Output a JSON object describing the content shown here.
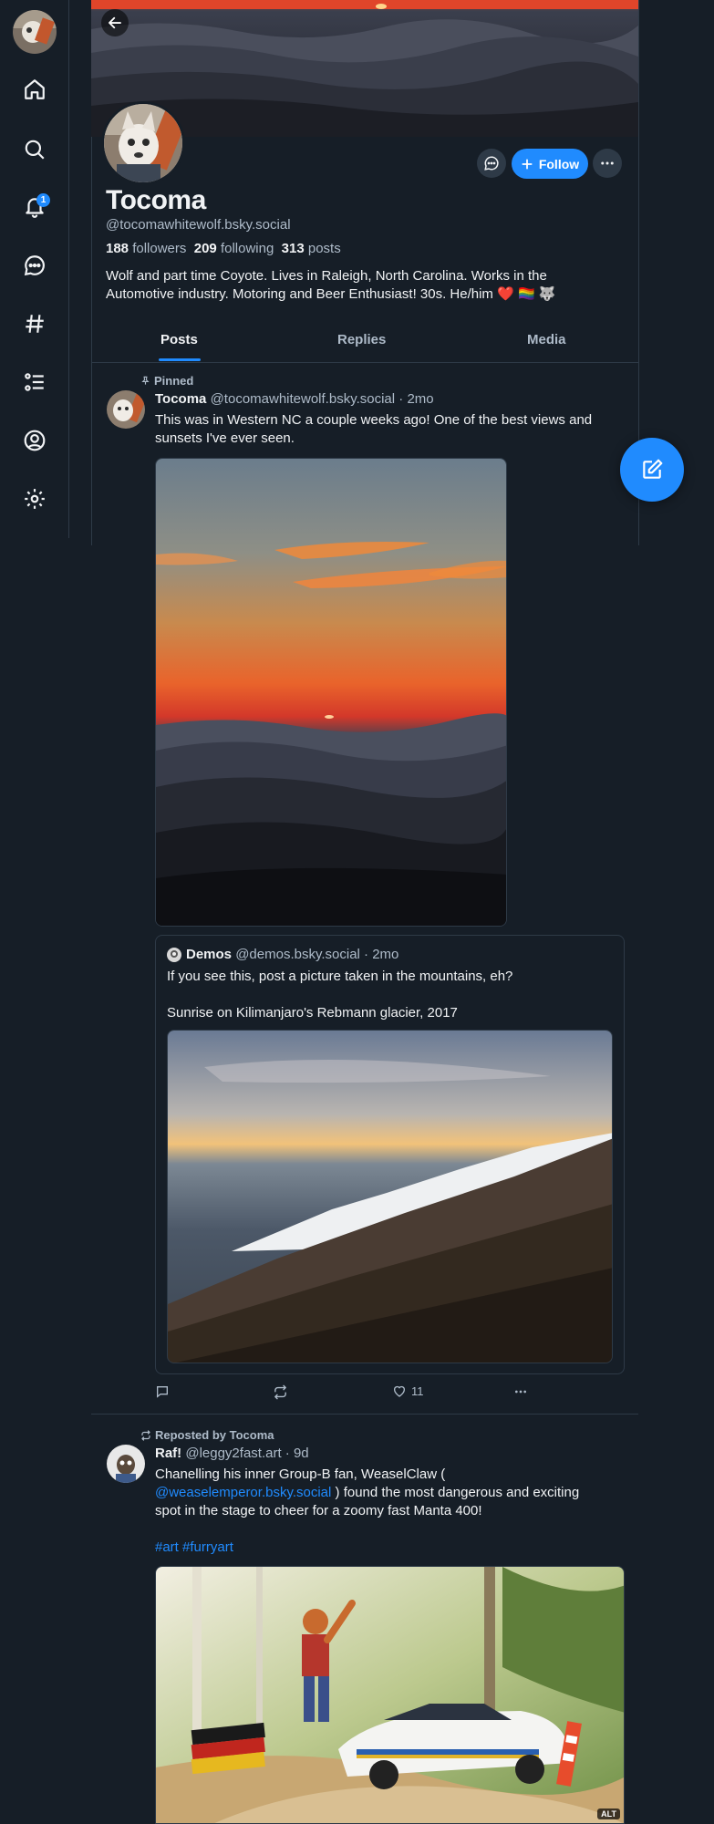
{
  "nav": {
    "badge_count": "1",
    "icons": [
      "home-icon",
      "search-icon",
      "bell-icon",
      "chat-icon",
      "hashtag-icon",
      "list-icon",
      "profile-icon",
      "gear-icon"
    ]
  },
  "profile": {
    "display_name": "Tocoma",
    "handle": "@tocomawhitewolf.bsky.social",
    "followers_count": "188",
    "followers_label": "followers",
    "following_count": "209",
    "following_label": "following",
    "posts_count": "313",
    "posts_label": "posts",
    "bio_line1": "Wolf and part time Coyote. Lives in Raleigh, North Carolina. Works in the",
    "bio_line2": "Automotive industry. Motoring and Beer Enthusiast! 30s. He/him ❤️ 🏳️‍🌈 🐺",
    "follow_label": "Follow"
  },
  "tabs": [
    {
      "label": "Posts"
    },
    {
      "label": "Replies"
    },
    {
      "label": "Media"
    }
  ],
  "colors": {
    "background": "#161e27",
    "accent": "#208bfe",
    "border": "#2e3a47",
    "muted_text": "#aebbc9"
  },
  "posts": [
    {
      "context": "Pinned",
      "author": "Tocoma",
      "handle": "@tocomawhitewolf.bsky.social",
      "time": "· 2mo",
      "text_line1": "This was in Western NC a couple weeks ago! One of the best views and",
      "text_line2": "sunsets I've ever seen.",
      "quote": {
        "author": "Demos",
        "handle": "@demos.bsky.social",
        "time": "· 2mo",
        "text_line1": "If you see this, post a picture taken in the mountains, eh?",
        "text_line2": "Sunrise on Kilimanjaro's Rebmann glacier, 2017"
      },
      "likes": "11"
    },
    {
      "context": "Reposted by Tocoma",
      "author": "Raf!",
      "handle": "@leggy2fast.art",
      "time": "· 9d",
      "text_line1": "Chanelling his inner Group-B fan, WeaselClaw (",
      "mention": "@weaselemperor.bsky.social",
      "text_line2_rest": " ) found the most dangerous and exciting",
      "text_line3": "spot in the stage to cheer for a zoomy fast Manta 400!",
      "hashtags": "#art #furryart",
      "alt_label": "ALT"
    }
  ]
}
